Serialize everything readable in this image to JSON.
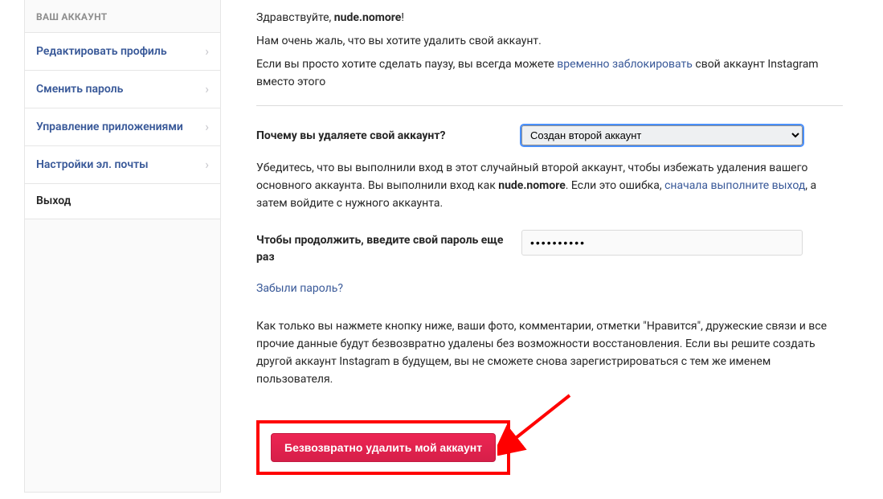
{
  "sidebar": {
    "header": "ВАШ АККАУНТ",
    "items": [
      {
        "label": "Редактировать профиль",
        "chevron": true
      },
      {
        "label": "Сменить пароль",
        "chevron": true
      },
      {
        "label": "Управление приложениями",
        "chevron": true
      },
      {
        "label": "Настройки эл. почты",
        "chevron": true
      },
      {
        "label": "Выход",
        "chevron": false
      }
    ]
  },
  "main": {
    "greeting_prefix": "Здравствуйте, ",
    "username": "nude.nomore",
    "greeting_suffix": "!",
    "sorry": "Нам очень жаль, что вы хотите удалить свой аккаунт.",
    "pause_before": "Если вы просто хотите сделать паузу, вы всегда можете ",
    "pause_link": "временно заблокировать",
    "pause_after": " свой аккаунт Instagram вместо этого",
    "reason_label": "Почему вы удаляете свой аккаунт?",
    "reason_value": "Создан второй аккаунт",
    "warn_before": "Убедитесь, что вы выполнили вход в этот случайный второй аккаунт, чтобы избежать удаления вашего основного аккаунта. Вы выполнили вход как ",
    "warn_user": "nude.nomore",
    "warn_mid": ". Если это ошибка, ",
    "warn_link": "сначала выполните выход",
    "warn_after": ", а затем войдите с нужного аккаунта.",
    "pwd_label": "Чтобы продолжить, введите свой пароль еще раз",
    "pwd_value": "••••••••••",
    "forgot": "Забыли пароль?",
    "final_warn": "Как только вы нажмете кнопку ниже, ваши фото, комментарии, отметки \"Нравится\", дружеские связи и все прочие данные будут безвозвратно удалены без возможности восстановления. Если вы решите создать другой аккаунт Instagram в будущем, вы не сможете снова зарегистрироваться с тем же именем пользователя.",
    "delete_button": "Безвозвратно удалить мой аккаунт"
  }
}
